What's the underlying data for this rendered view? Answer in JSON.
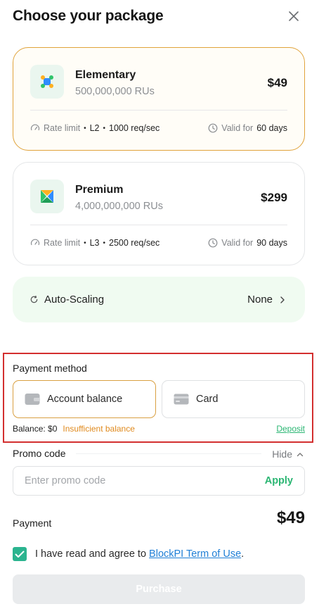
{
  "header": {
    "title": "Choose your package"
  },
  "packages": [
    {
      "name": "Elementary",
      "rus": "500,000,000 RUs",
      "price": "$49",
      "rate_prefix": "Rate limit",
      "level": "L2",
      "rate": "1000 req/sec",
      "valid_prefix": "Valid for",
      "valid": "60 days",
      "selected": true
    },
    {
      "name": "Premium",
      "rus": "4,000,000,000 RUs",
      "price": "$299",
      "rate_prefix": "Rate limit",
      "level": "L3",
      "rate": "2500 req/sec",
      "valid_prefix": "Valid for",
      "valid": "90 days",
      "selected": false
    }
  ],
  "autoscaling": {
    "label": "Auto-Scaling",
    "value": "None"
  },
  "payment_method": {
    "label": "Payment method",
    "options": [
      {
        "label": "Account balance",
        "icon": "wallet-icon",
        "selected": true
      },
      {
        "label": "Card",
        "icon": "card-icon",
        "selected": false
      }
    ],
    "balance": "Balance: $0",
    "warning": "Insufficient balance",
    "deposit": "Deposit"
  },
  "promo": {
    "label": "Promo code",
    "toggle": "Hide",
    "placeholder": "Enter promo code",
    "apply": "Apply"
  },
  "payment": {
    "label": "Payment",
    "amount": "$49"
  },
  "agreement": {
    "checked": true,
    "text": "I have read and agree to",
    "link": "BlockPI Term of Use",
    "suffix": "."
  },
  "purchase": {
    "label": "Purchase"
  },
  "colors": {
    "accent_green": "#2bb673",
    "checkbox_green": "#2bb48f",
    "selected_border": "#e0a33b",
    "warning_orange": "#e08a1e",
    "highlight_red": "#d32f2f",
    "link_blue": "#1f7fd6"
  }
}
